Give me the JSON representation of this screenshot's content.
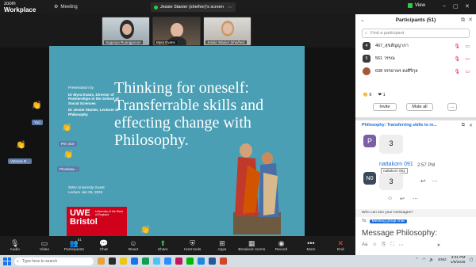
{
  "app": {
    "logo_top": "zoom",
    "logo_bottom": "Workplace"
  },
  "meeting": {
    "label": "Meeting",
    "share_banner": "Jessie Stanier (she/her)'s screen"
  },
  "video_tiles": [
    {
      "name": "Sugunya Ruangjaroon"
    },
    {
      "name": "Myra Evans"
    },
    {
      "name": "Jessie Stanier (she/her)"
    }
  ],
  "slide": {
    "presenter_intro": "Presentation by",
    "presenter1": "Dr Myra Evans, Director of Partnerships in the School of Social Sciences",
    "presenter2": "Dr Jessie Stanier, Lecturer in Philosophy",
    "title": "Thinking for oneself: Transferrable skills and effecting change with Philosophy.",
    "guest_line1": "SWU University Guest",
    "guest_line2": "Lecture Jan 08, 2026",
    "brand_main": "UWE Bristol",
    "brand_sub": "University of the West of England"
  },
  "side_labels": [
    "Yoo",
    "Pim 310",
    "Phodsaw...",
    "Vetrana R..."
  ],
  "toolbar": {
    "items": [
      {
        "label": "Audio",
        "icon": "mic-icon"
      },
      {
        "label": "Video",
        "icon": "video-icon"
      },
      {
        "label": "Participants",
        "icon": "participants-icon",
        "count": "51"
      },
      {
        "label": "Chat",
        "icon": "chat-icon"
      },
      {
        "label": "React",
        "icon": "react-icon"
      },
      {
        "label": "Share",
        "icon": "share-icon"
      },
      {
        "label": "Host tools",
        "icon": "shield-icon"
      },
      {
        "label": "Apps",
        "icon": "apps-icon"
      },
      {
        "label": "Breakout rooms",
        "icon": "breakout-icon"
      },
      {
        "label": "Record",
        "icon": "record-icon"
      },
      {
        "label": "More",
        "icon": "more-icon"
      },
      {
        "label": "End",
        "icon": "end-icon"
      }
    ]
  },
  "panel": {
    "view_label": "View",
    "participants_title": "Participants (51)",
    "find_placeholder": "Find a participant",
    "participants": [
      {
        "initial": "4",
        "name": "467_สุขสัญญาภา"
      },
      {
        "initial": "5",
        "name": "561 วรรณ"
      },
      {
        "initial": "",
        "name": "638 จรรยาพร ตงศิริกุล"
      }
    ],
    "reactions": {
      "clap": "6",
      "heart": "1"
    },
    "invite_label": "Invite",
    "mute_all_label": "Mute all",
    "more_label": "...",
    "chat_title": "Philosophy: Transferring skills to re...",
    "messages": [
      {
        "avatar": "P",
        "avatar_color": "#7b5ea7",
        "text": "3"
      },
      {
        "avatar": "N0",
        "avatar_color": "#3a4a5a",
        "sender": "nattakorn 091",
        "time": "2:57 PM",
        "tooltip": "nattakorn 091",
        "text": "3"
      }
    ],
    "who_can_see": "Who can see your messages?",
    "to_label": "To:",
    "to_target": "Meeting group chat",
    "input_placeholder": "Message Philosophy:"
  },
  "taskbar": {
    "search_placeholder": "Type here to search",
    "lang": "ENG",
    "time": "3:01 PM",
    "date": "1/8/2026"
  }
}
